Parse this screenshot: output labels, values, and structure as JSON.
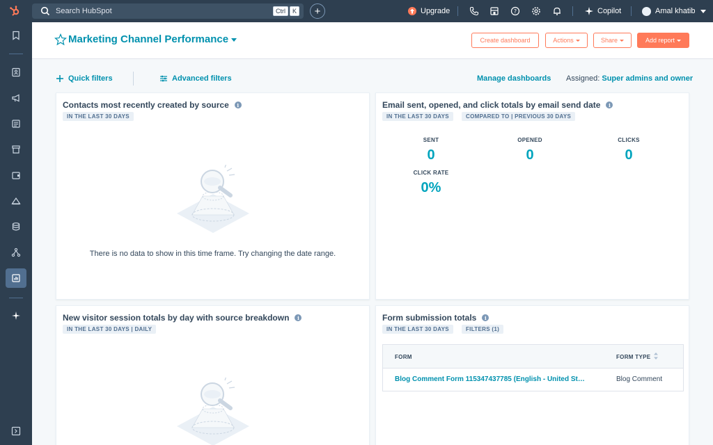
{
  "colors": {
    "nav_bg": "#2e3f50",
    "accent_teal": "#0091ae",
    "accent_orange": "#ff7a59",
    "metric_teal": "#00a4bd"
  },
  "topbar": {
    "logo_icon": "hubspot-sprocket-icon",
    "search_placeholder": "Search HubSpot",
    "shortcut_key1": "Ctrl",
    "shortcut_key2": "K",
    "upgrade_label": "Upgrade",
    "copilot_label": "Copilot",
    "user_name": "Amal khatib"
  },
  "sidebar": {
    "items": [
      "bookmark-icon",
      "contacts-icon",
      "megaphone-icon",
      "content-icon",
      "commerce-icon",
      "service-icon",
      "automation-icon",
      "data-icon",
      "library-icon",
      "reports-icon",
      "breeze-icon",
      "expand-icon"
    ]
  },
  "header": {
    "title": "Marketing Channel Performance",
    "create_dashboard": "Create dashboard",
    "actions": "Actions",
    "share": "Share",
    "add_report": "Add report"
  },
  "filters": {
    "quick": "Quick filters",
    "advanced": "Advanced filters",
    "manage": "Manage dashboards",
    "assigned_label": "Assigned:",
    "assigned_value": "Super admins and owner"
  },
  "cards": {
    "contacts": {
      "title": "Contacts most recently created by source",
      "tag1": "IN THE LAST 30 DAYS",
      "empty": "There is no data to show in this time frame. Try changing the date range."
    },
    "email": {
      "title": "Email sent, opened, and click totals by email send date",
      "tag1": "IN THE LAST 30 DAYS",
      "tag2": "COMPARED TO | PREVIOUS 30 DAYS",
      "metrics": [
        {
          "label": "SENT",
          "value": "0"
        },
        {
          "label": "OPENED",
          "value": "0"
        },
        {
          "label": "CLICKS",
          "value": "0"
        },
        {
          "label": "CLICK RATE",
          "value": "0%"
        }
      ]
    },
    "sessions": {
      "title": "New visitor session totals by day with source breakdown",
      "tag1": "IN THE LAST 30 DAYS | DAILY"
    },
    "forms": {
      "title": "Form submission totals",
      "tag1": "IN THE LAST 30 DAYS",
      "tag2": "FILTERS (1)",
      "columns": [
        "FORM",
        "FORM TYPE"
      ],
      "rows": [
        {
          "form": "Blog Comment Form 115347437785 (English - United St…",
          "type": "Blog Comment"
        }
      ]
    }
  }
}
